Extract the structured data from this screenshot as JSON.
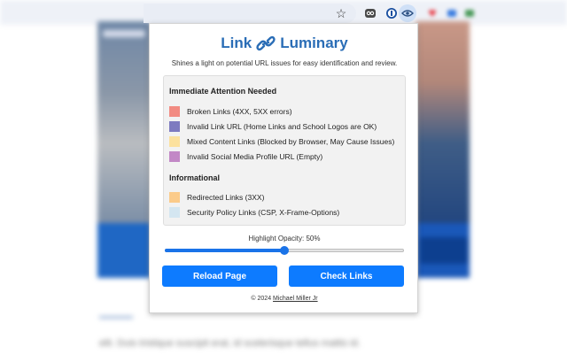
{
  "background": {
    "paragraph_text": "elit. Duis tristique suscipit erat, id scelerisque tellus mattis id."
  },
  "toolbar": {
    "icons": [
      "star-icon",
      "owl-extension-icon",
      "password-manager-icon",
      "link-luminary-eye-icon",
      "extension-icon",
      "extension-icon",
      "extension-icon"
    ],
    "active_extension_color": "#cfe0f7"
  },
  "popup": {
    "title_part1": "Link",
    "title_part2": "Luminary",
    "title_icon": "chain-link-icon",
    "title_color": "#2a6db6",
    "subtitle": "Shines a light on potential URL issues for easy identification and review.",
    "sections": [
      {
        "title": "Immediate Attention Needed",
        "items": [
          {
            "label": "Broken Links (4XX, 5XX errors)",
            "color": "#f28b82"
          },
          {
            "label": "Invalid Link URL (Home Links and School Logos are OK)",
            "color": "#7e7bc0"
          },
          {
            "label": "Mixed Content Links (Blocked by Browser, May Cause Issues)",
            "color": "#fce19e"
          },
          {
            "label": "Invalid Social Media Profile URL (Empty)",
            "color": "#c288c6"
          }
        ]
      },
      {
        "title": "Informational",
        "items": [
          {
            "label": "Redirected Links (3XX)",
            "color": "#fbcb8a"
          },
          {
            "label": "Security Policy Links (CSP, X-Frame-Options)",
            "color": "#d4e6f1"
          }
        ]
      }
    ],
    "opacity": {
      "label": "Highlight Opacity: 50%",
      "value_fraction": 0.5
    },
    "buttons": {
      "reload": "Reload Page",
      "check": "Check Links"
    },
    "accent_color": "#0d7bff",
    "footer": {
      "prefix": "© 2024",
      "author": "Michael Miller Jr"
    }
  }
}
